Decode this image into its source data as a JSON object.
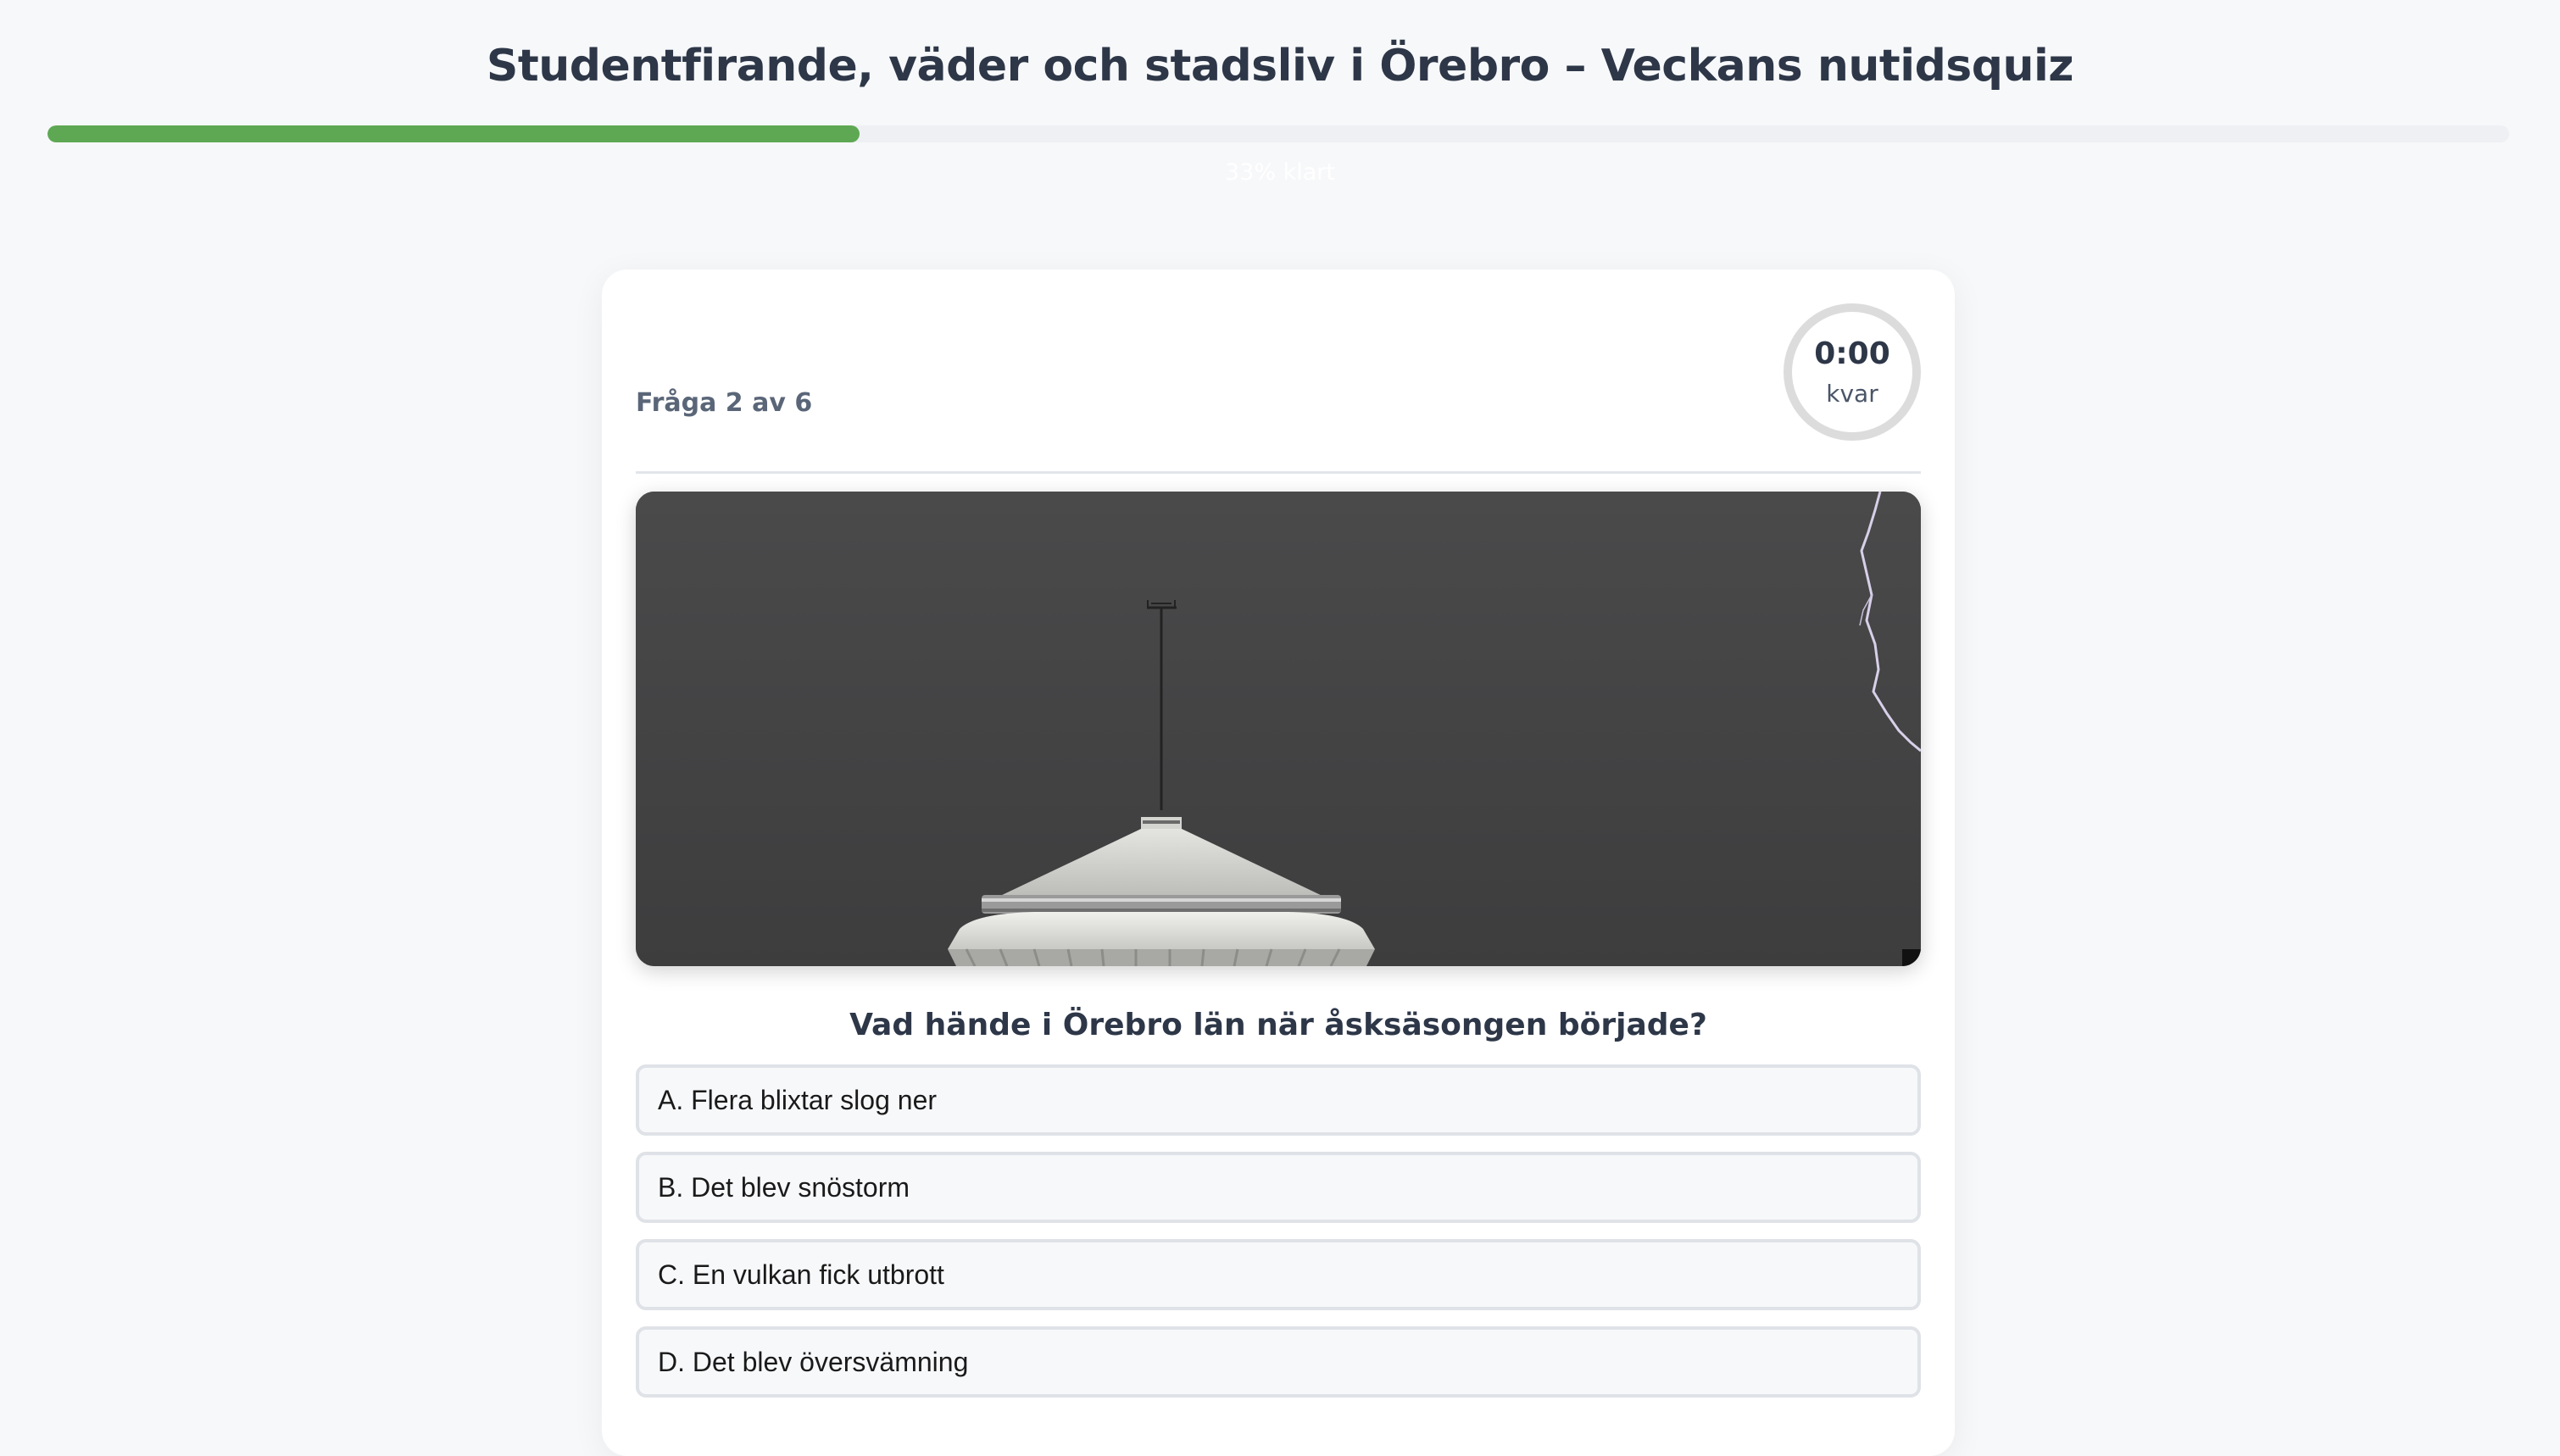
{
  "header": {
    "title": "Studentfirande, väder och stadsliv i Örebro – Veckans nutidsquiz",
    "progress_percent": 33,
    "progress_text": "33% klart"
  },
  "quiz": {
    "counter": "Fråga 2 av 6",
    "timer": {
      "value": "0:00",
      "label": "kvar"
    },
    "image": {
      "subject": "water-tower-lightning-photo"
    },
    "question": "Vad hände i Örebro län när åsksäsongen började?",
    "options": [
      "A. Flera blixtar slog ner",
      "B. Det blev snöstorm",
      "C. En vulkan fick utbrott",
      "D. Det blev översvämning"
    ]
  },
  "colors": {
    "background": "#f7f8fa",
    "progress_fill": "#5ea853",
    "progress_track": "#eef0f3",
    "title_text": "#2d3748",
    "card": "#ffffff",
    "option_border": "#dfe2e7"
  }
}
